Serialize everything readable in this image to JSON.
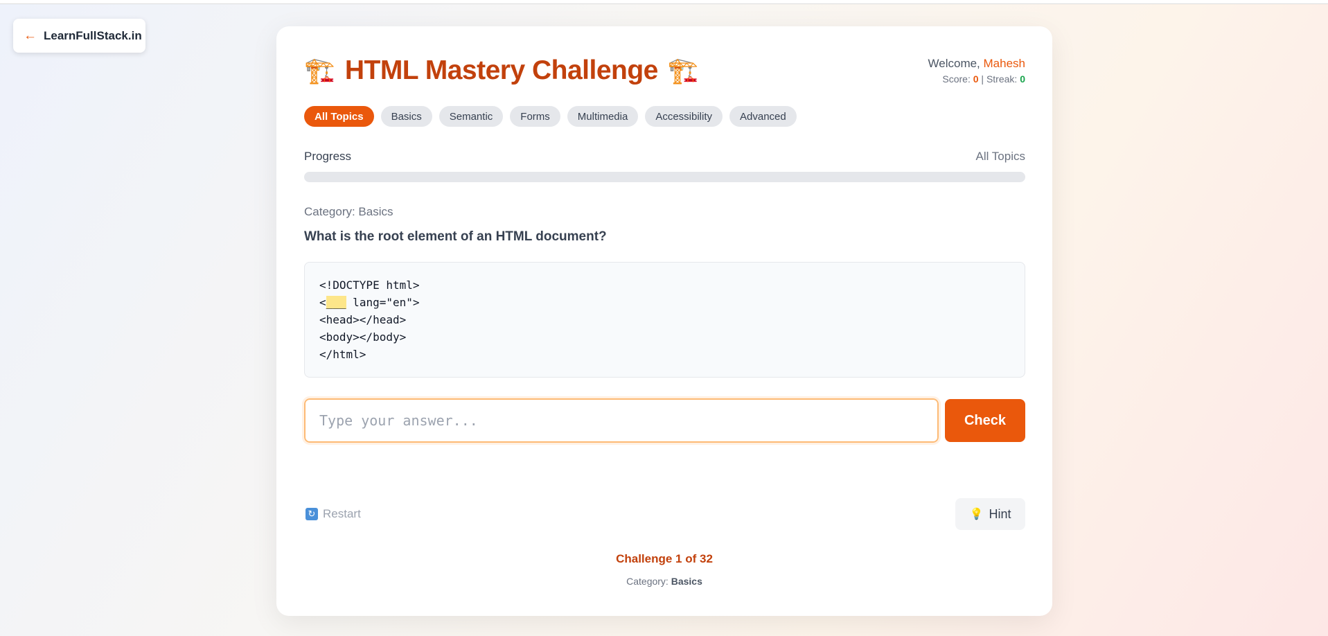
{
  "back_link": {
    "arrow": "←",
    "label": "LearnFullStack.in"
  },
  "header": {
    "title": "HTML Mastery Challenge",
    "title_icon": "🏗️",
    "welcome_prefix": "Welcome,",
    "user_name": "Mahesh",
    "score_label": "Score:",
    "score": "0",
    "separator": "|",
    "streak_label": "Streak:",
    "streak": "0"
  },
  "topics": [
    {
      "label": "All Topics",
      "active": true
    },
    {
      "label": "Basics"
    },
    {
      "label": "Semantic"
    },
    {
      "label": "Forms"
    },
    {
      "label": "Multimedia"
    },
    {
      "label": "Accessibility"
    },
    {
      "label": "Advanced"
    }
  ],
  "progress": {
    "label": "Progress",
    "topic": "All Topics",
    "fraction": 0
  },
  "question": {
    "category_line": "Category: Basics",
    "text": "What is the root element of an HTML document?",
    "code": {
      "line1": "<!DOCTYPE html>",
      "line2_prefix": "<",
      "line2_blank": "___",
      "line2_suffix": " lang=\"en\">",
      "line3": "<head></head>",
      "line4": "<body></body>",
      "line5": "</html>"
    }
  },
  "answer": {
    "placeholder": "Type your answer...",
    "value": "",
    "check_label": "Check"
  },
  "actions": {
    "restart_label": "Restart",
    "restart_icon": "🔄",
    "hint_label": "Hint",
    "hint_icon": "💡"
  },
  "footer": {
    "challenge_count": "Challenge 1 of 32",
    "category_prefix": "Category:",
    "category": "Basics"
  },
  "colors": {
    "accent": "#ea580c",
    "title": "#c2410c",
    "streak": "#16a34a"
  }
}
